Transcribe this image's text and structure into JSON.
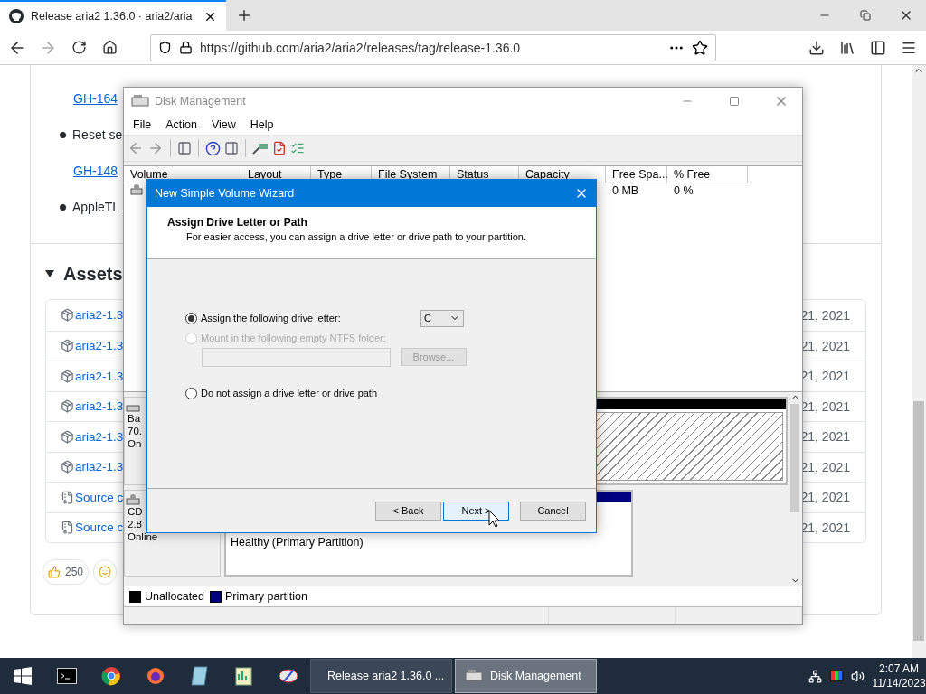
{
  "browser": {
    "tab": {
      "title": "Release aria2 1.36.0 · aria2/aria"
    },
    "url": "https://github.com/aria2/aria2/releases/tag/release-1.36.0"
  },
  "page": {
    "notes": [
      {
        "kind": "link",
        "text": "GH-164"
      },
      {
        "kind": "bullet",
        "text": "Reset se"
      },
      {
        "kind": "link",
        "text": "GH-148"
      },
      {
        "kind": "bullet",
        "text": "AppleTL"
      }
    ],
    "assets_title": "Assets",
    "assets": [
      {
        "kind": "package",
        "name": "aria2-1.3",
        "date": "21, 2021"
      },
      {
        "kind": "package",
        "name": "aria2-1.3",
        "date": "21, 2021"
      },
      {
        "kind": "package",
        "name": "aria2-1.3",
        "date": "21, 2021"
      },
      {
        "kind": "package",
        "name": "aria2-1.3",
        "date": "21, 2021"
      },
      {
        "kind": "package",
        "name": "aria2-1.3",
        "date": "21, 2021"
      },
      {
        "kind": "package",
        "name": "aria2-1.3",
        "date": "21, 2021"
      },
      {
        "kind": "source",
        "name": "Source c",
        "date": "21, 2021"
      },
      {
        "kind": "source",
        "name": "Source c",
        "date": "21, 2021"
      }
    ],
    "reactions": [
      {
        "kind": "thumbs-up",
        "count": "250"
      },
      {
        "kind": "smile"
      }
    ]
  },
  "disk_management": {
    "title": "Disk Management",
    "menu": [
      "File",
      "Action",
      "View",
      "Help"
    ],
    "columns": [
      "Volume",
      "Layout",
      "Type",
      "File System",
      "Status",
      "Capacity",
      "Free Spa...",
      "% Free"
    ],
    "volumes": [
      {
        "free_space": "0 MB",
        "percent_free": "0 %"
      }
    ],
    "disks": [
      {
        "kind": "basic",
        "lines": [
          "Ba",
          "70.",
          "On"
        ],
        "partitions": [
          {
            "kind": "unallocated"
          }
        ]
      },
      {
        "kind": "cdrom",
        "lines": [
          "CD",
          "2.8",
          "Online"
        ],
        "partitions": [
          {
            "kind": "primary",
            "status": "Healthy (Primary Partition)"
          }
        ]
      }
    ],
    "legend": [
      {
        "label": "Unallocated",
        "color": "#000000"
      },
      {
        "label": "Primary partition",
        "color": "#000080"
      }
    ]
  },
  "wizard": {
    "title": "New Simple Volume Wizard",
    "heading": "Assign Drive Letter or Path",
    "description": "For easier access, you can assign a drive letter or drive path to your partition.",
    "options": [
      {
        "label": "Assign the following drive letter:",
        "selected": true,
        "disabled": false
      },
      {
        "label": "Mount in the following empty NTFS folder:",
        "selected": false,
        "disabled": true
      },
      {
        "label": "Do not assign a drive letter or drive path",
        "selected": false,
        "disabled": false
      }
    ],
    "drive_letter": "C",
    "browse": "Browse...",
    "buttons": [
      {
        "label": "< Back",
        "focused": false
      },
      {
        "label": "Next >",
        "focused": true
      },
      {
        "label": "Cancel",
        "focused": false
      }
    ]
  },
  "taskbar": {
    "windows": [
      {
        "kind": "firefox",
        "title": "Release aria2 1.36.0 ...",
        "selected": false
      },
      {
        "kind": "disk",
        "title": "Disk Management",
        "selected": true
      }
    ],
    "time": "2:07 AM",
    "date": "11/14/2023"
  }
}
